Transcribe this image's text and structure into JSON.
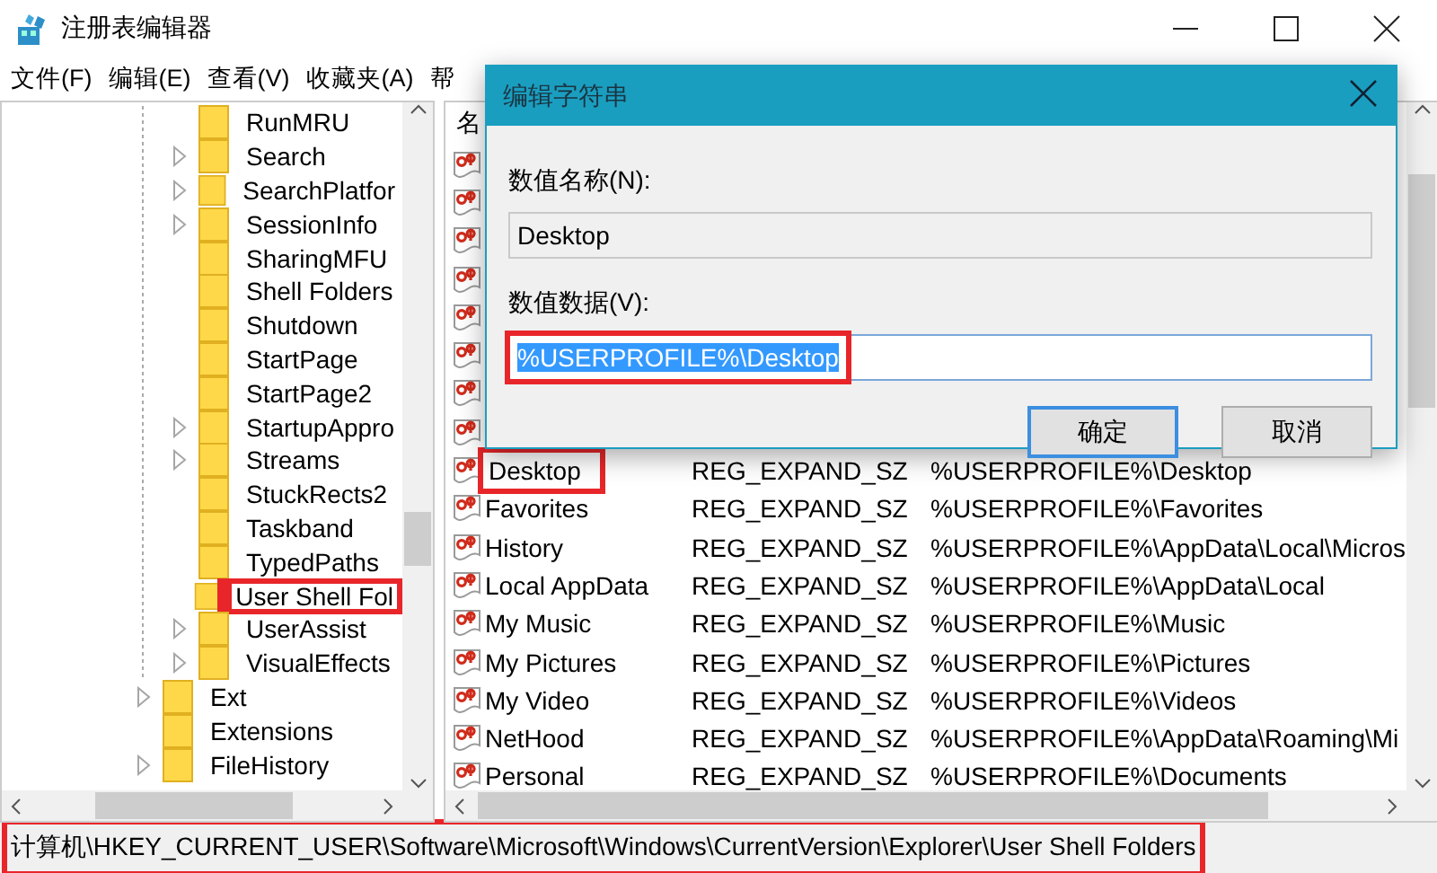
{
  "window": {
    "title": "注册表编辑器"
  },
  "menu": [
    "文件(F)",
    "编辑(E)",
    "查看(V)",
    "收藏夹(A)",
    "帮"
  ],
  "tree": {
    "items": [
      {
        "children": [
          {
            "label": "RunMRU",
            "has_children": false,
            "highlighted": false
          },
          {
            "label": "Search",
            "has_children": true,
            "highlighted": false
          },
          {
            "label": "SearchPlatfor",
            "has_children": true,
            "highlighted": false
          },
          {
            "label": "SessionInfo",
            "has_children": true,
            "highlighted": false
          },
          {
            "label": "SharingMFU",
            "has_children": false,
            "highlighted": false
          },
          {
            "label": "Shell Folders",
            "has_children": false,
            "highlighted": false
          },
          {
            "label": "Shutdown",
            "has_children": false,
            "highlighted": false
          },
          {
            "label": "StartPage",
            "has_children": false,
            "highlighted": false
          },
          {
            "label": "StartPage2",
            "has_children": false,
            "highlighted": false
          },
          {
            "label": "StartupAppro",
            "has_children": true,
            "highlighted": false
          },
          {
            "label": "Streams",
            "has_children": true,
            "highlighted": false
          },
          {
            "label": "StuckRects2",
            "has_children": false,
            "highlighted": false
          },
          {
            "label": "Taskband",
            "has_children": false,
            "highlighted": false
          },
          {
            "label": "TypedPaths",
            "has_children": false,
            "highlighted": false
          },
          {
            "label": "User Shell Fol",
            "has_children": false,
            "highlighted": true
          },
          {
            "label": "UserAssist",
            "has_children": true,
            "highlighted": false
          },
          {
            "label": "VisualEffects",
            "has_children": true,
            "highlighted": false
          }
        ]
      },
      {
        "label": "Ext",
        "has_children": true,
        "highlighted": false
      },
      {
        "label": "Extensions",
        "has_children": false,
        "highlighted": false
      },
      {
        "label": "FileHistory",
        "has_children": true,
        "highlighted": false
      }
    ]
  },
  "list": {
    "columns": [
      "名"
    ],
    "rows": [
      {
        "kind": "covered"
      },
      {
        "kind": "covered"
      },
      {
        "kind": "covered"
      },
      {
        "kind": "covered"
      },
      {
        "kind": "covered"
      },
      {
        "kind": "covered"
      },
      {
        "kind": "covered"
      },
      {
        "kind": "covered"
      },
      {
        "kind": "value",
        "name": "Desktop",
        "type": "REG_EXPAND_SZ",
        "data": "%USERPROFILE%\\Desktop",
        "highlighted": true
      },
      {
        "kind": "value",
        "name": "Favorites",
        "type": "REG_EXPAND_SZ",
        "data": "%USERPROFILE%\\Favorites",
        "highlighted": false
      },
      {
        "kind": "value",
        "name": "History",
        "type": "REG_EXPAND_SZ",
        "data": "%USERPROFILE%\\AppData\\Local\\Micros",
        "highlighted": false
      },
      {
        "kind": "value",
        "name": "Local AppData",
        "type": "REG_EXPAND_SZ",
        "data": "%USERPROFILE%\\AppData\\Local",
        "highlighted": false
      },
      {
        "kind": "value",
        "name": "My Music",
        "type": "REG_EXPAND_SZ",
        "data": "%USERPROFILE%\\Music",
        "highlighted": false
      },
      {
        "kind": "value",
        "name": "My Pictures",
        "type": "REG_EXPAND_SZ",
        "data": "%USERPROFILE%\\Pictures",
        "highlighted": false
      },
      {
        "kind": "value",
        "name": "My Video",
        "type": "REG_EXPAND_SZ",
        "data": "%USERPROFILE%\\Videos",
        "highlighted": false
      },
      {
        "kind": "value",
        "name": "NetHood",
        "type": "REG_EXPAND_SZ",
        "data": "%USERPROFILE%\\AppData\\Roaming\\Mi",
        "highlighted": false
      },
      {
        "kind": "value",
        "name": "Personal",
        "type": "REG_EXPAND_SZ",
        "data": "%USERPROFILE%\\Documents",
        "highlighted": false
      }
    ]
  },
  "dialog": {
    "title": "编辑字符串",
    "name_label": "数值名称(N):",
    "name_value": "Desktop",
    "data_label": "数值数据(V):",
    "data_value": "%USERPROFILE%\\Desktop",
    "data_selected": true,
    "data_highlighted": true,
    "buttons": [
      {
        "label": "确定",
        "default": true
      },
      {
        "label": "取消",
        "default": false
      }
    ]
  },
  "status_bar": {
    "path": "计算机\\HKEY_CURRENT_USER\\Software\\Microsoft\\Windows\\CurrentVersion\\Explorer\\User Shell Folders",
    "highlighted": true
  }
}
